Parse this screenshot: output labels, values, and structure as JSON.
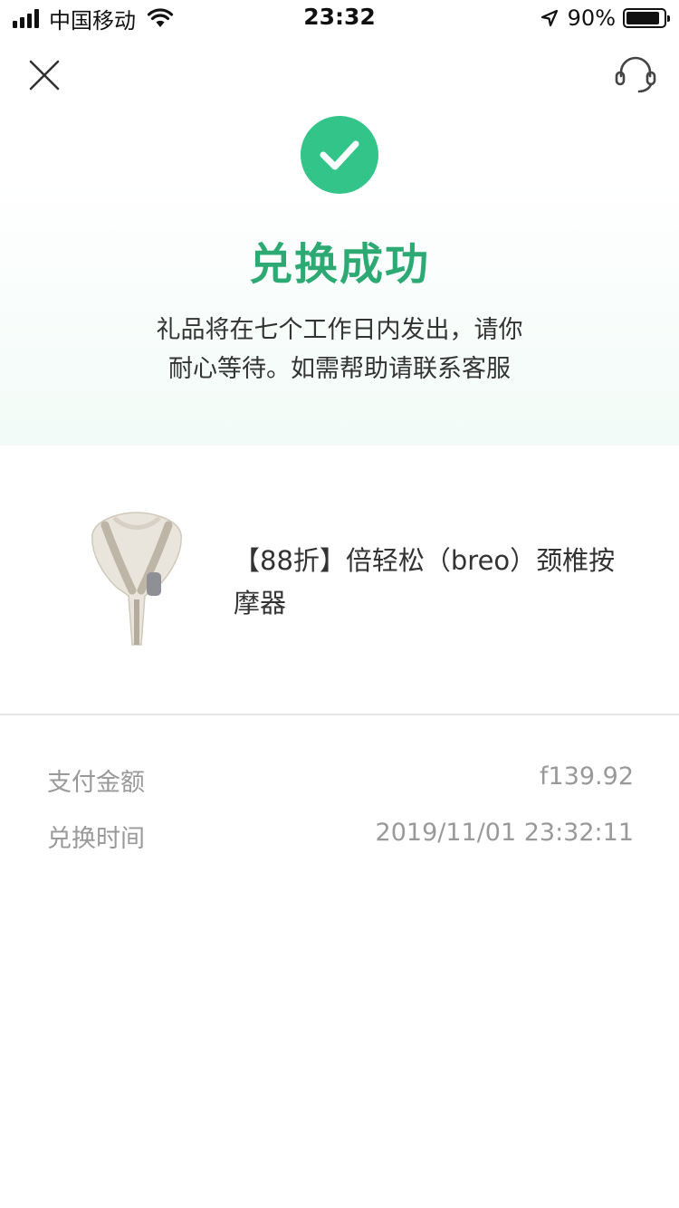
{
  "status_bar": {
    "carrier": "中国移动",
    "time": "23:32",
    "battery_percent": "90%",
    "battery_level": 0.9,
    "icons": [
      "signal-icon",
      "wifi-icon",
      "location-arrow-icon",
      "battery-icon"
    ]
  },
  "nav": {
    "close_icon": "close-icon",
    "service_icon": "headset-icon"
  },
  "result": {
    "icon": "check-circle-icon",
    "title": "兑换成功",
    "desc_line1": "礼品将在七个工作日内发出，请你",
    "desc_line2": "耐心等待。如需帮助请联系客服"
  },
  "product": {
    "name": "【88折】倍轻松（breo）颈椎按摩器",
    "image": "neck-massager-image"
  },
  "info": {
    "amount_label": "支付金额",
    "amount_value": "f139.92",
    "time_label": "兑换时间",
    "time_value": "2019/11/01 23:32:11"
  },
  "colors": {
    "accent_green": "#33c48a",
    "title_green": "#2daa73",
    "muted_text": "#999999"
  }
}
